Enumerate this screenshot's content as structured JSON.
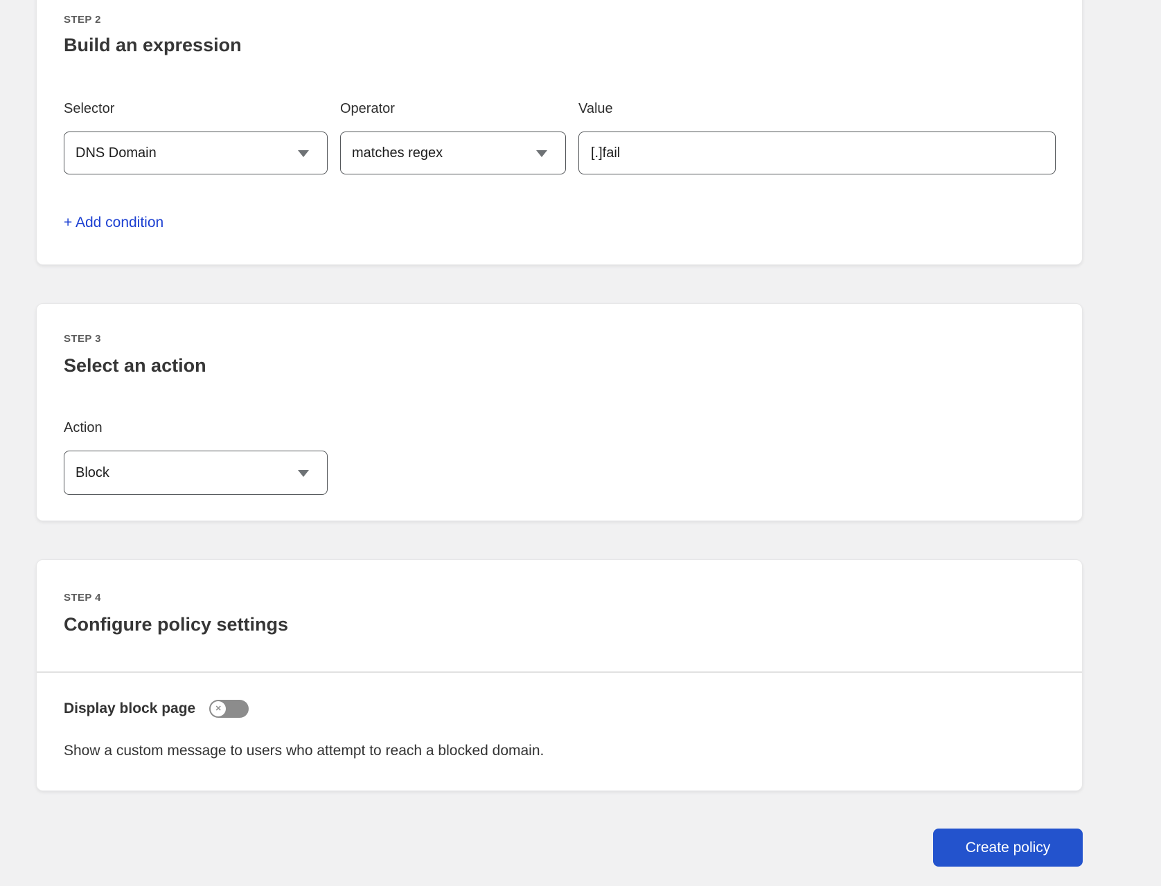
{
  "page": {
    "background": "#f1f1f2"
  },
  "colors": {
    "link_blue": "#1b3fd1",
    "button_blue": "#2353cd",
    "toggle_off_gray": "#8c8c8c"
  },
  "icons": {
    "dropdown_caret": "chevron-down",
    "toggle_knob_glyph": "x-circle"
  },
  "step2": {
    "step_label": "STEP 2",
    "title": "Build an expression",
    "selector": {
      "label": "Selector",
      "value": "DNS Domain"
    },
    "operator": {
      "label": "Operator",
      "value": "matches regex"
    },
    "value": {
      "label": "Value",
      "text": "[.]fail"
    },
    "add_condition_link": "+ Add condition"
  },
  "step3": {
    "step_label": "STEP 3",
    "title": "Select an action",
    "action": {
      "label": "Action",
      "value": "Block"
    }
  },
  "step4": {
    "step_label": "STEP 4",
    "title": "Configure policy settings",
    "display_block_page": {
      "label": "Display block page",
      "state": "off"
    },
    "description": "Show a custom message to users who attempt to reach a blocked domain."
  },
  "footer": {
    "create_policy_button": "Create policy"
  }
}
